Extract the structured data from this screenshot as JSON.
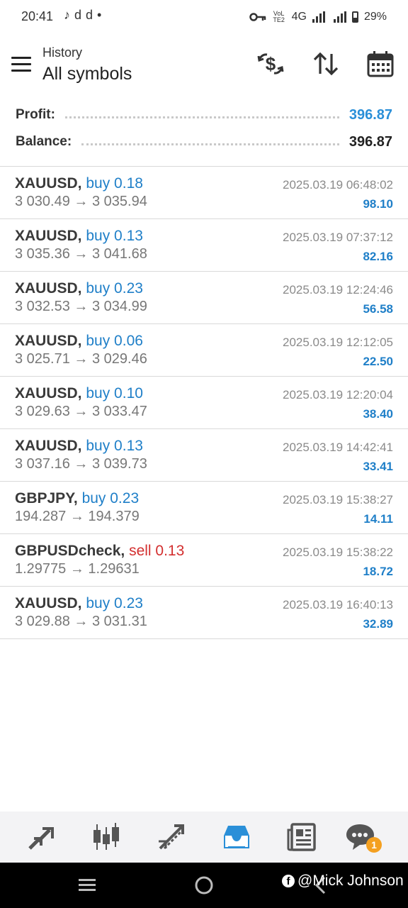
{
  "status_bar": {
    "time": "20:41",
    "left_icons": [
      "tiktok-icon",
      "d",
      "d",
      "•"
    ],
    "volte_label": "VoLTE2",
    "network": "4G",
    "battery": "29%"
  },
  "header": {
    "subtitle": "History",
    "title": "All symbols"
  },
  "summary": {
    "profit_label": "Profit:",
    "profit_value": "396.87",
    "balance_label": "Balance:",
    "balance_value": "396.87"
  },
  "trades": [
    {
      "symbol": "XAUUSD,",
      "side": "buy 0.18",
      "prices": "3 030.49 → 3 035.94",
      "time": "2025.03.19 06:48:02",
      "profit": "98.10"
    },
    {
      "symbol": "XAUUSD,",
      "side": "buy 0.13",
      "prices": "3 035.36 → 3 041.68",
      "time": "2025.03.19 07:37:12",
      "profit": "82.16"
    },
    {
      "symbol": "XAUUSD,",
      "side": "buy 0.23",
      "prices": "3 032.53 → 3 034.99",
      "time": "2025.03.19 12:24:46",
      "profit": "56.58"
    },
    {
      "symbol": "XAUUSD,",
      "side": "buy 0.06",
      "prices": "3 025.71 → 3 029.46",
      "time": "2025.03.19 12:12:05",
      "profit": "22.50"
    },
    {
      "symbol": "XAUUSD,",
      "side": "buy 0.10",
      "prices": "3 029.63 → 3 033.47",
      "time": "2025.03.19 12:20:04",
      "profit": "38.40"
    },
    {
      "symbol": "XAUUSD,",
      "side": "buy 0.13",
      "prices": "3 037.16 → 3 039.73",
      "time": "2025.03.19 14:42:41",
      "profit": "33.41"
    },
    {
      "symbol": "GBPJPY,",
      "side": "buy 0.23",
      "prices": "194.287 → 194.379",
      "time": "2025.03.19 15:38:27",
      "profit": "14.11"
    },
    {
      "symbol": "GBPUSDcheck,",
      "side": "sell 0.13",
      "prices": "1.29775 → 1.29631",
      "time": "2025.03.19 15:38:22",
      "profit": "18.72"
    },
    {
      "symbol": "XAUUSD,",
      "side": "buy 0.23",
      "prices": "3 029.88 → 3 031.31",
      "time": "2025.03.19 16:40:13",
      "profit": "32.89"
    }
  ],
  "bottom_nav": {
    "items": [
      "quotes-icon",
      "chart-icon",
      "trade-icon",
      "history-icon",
      "news-icon",
      "chat-icon"
    ],
    "active": "history-icon",
    "chat_badge": "1"
  },
  "watermark": {
    "text": "@Mick Johnson",
    "platform_icon": "f"
  },
  "colors": {
    "buy": "#1f7fc8",
    "sell": "#d32f2f",
    "profit": "#1f7fc8",
    "accent": "#2a8fd8",
    "text_dark": "#2b2b2b",
    "text_muted": "#777777"
  }
}
